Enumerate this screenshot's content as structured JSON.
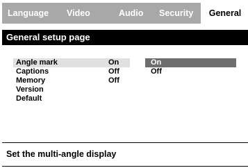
{
  "tabs": [
    {
      "label": "Language",
      "active": false
    },
    {
      "label": "Video",
      "active": false
    },
    {
      "label": "Audio",
      "active": false
    },
    {
      "label": "Security",
      "active": false
    },
    {
      "label": "General",
      "active": true
    }
  ],
  "page": {
    "title": "General setup page"
  },
  "settings": [
    {
      "label": "Angle mark",
      "value": "On",
      "selected": true
    },
    {
      "label": "Captions",
      "value": "Off",
      "selected": false
    },
    {
      "label": "Memory",
      "value": "Off",
      "selected": false
    },
    {
      "label": "Version",
      "value": "",
      "selected": false
    },
    {
      "label": "Default",
      "value": "",
      "selected": false
    }
  ],
  "options": [
    {
      "label": "On",
      "highlighted": true
    },
    {
      "label": "Off",
      "highlighted": false
    }
  ],
  "footer": {
    "help_text": "Set the multi-angle display"
  },
  "colors": {
    "tabbar_bg": "#a8a8a8",
    "header_bg": "#000000",
    "selected_option_bg": "#6e6e6e",
    "row_highlight_bg": "#e0e0e0"
  }
}
